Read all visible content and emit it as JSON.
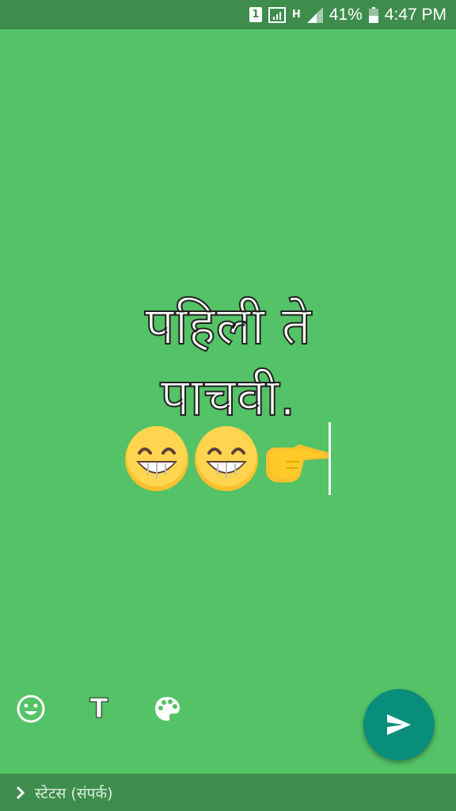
{
  "status_bar": {
    "sim_slot": "1",
    "network_type": "H",
    "battery_percent": "41%",
    "time": "4:47 PM",
    "icons": [
      "sim-icon",
      "signal-box-icon",
      "network-type-icon",
      "cell-signal-icon",
      "battery-icon"
    ]
  },
  "editor": {
    "text_line1": "पहिली ते",
    "text_line2": "पाचवी.",
    "emojis": [
      "grinning-face-emoji",
      "grinning-face-emoji",
      "pointing-right-emoji"
    ],
    "background_color": "#54c266"
  },
  "toolbar": {
    "emoji_icon": "smiley-icon",
    "text_icon": "T",
    "color_icon": "palette-icon"
  },
  "send": {
    "icon": "send-icon",
    "color": "#098e7c"
  },
  "footer": {
    "icon": "chevron-right-icon",
    "label": "स्टेटस (संपर्क)"
  }
}
